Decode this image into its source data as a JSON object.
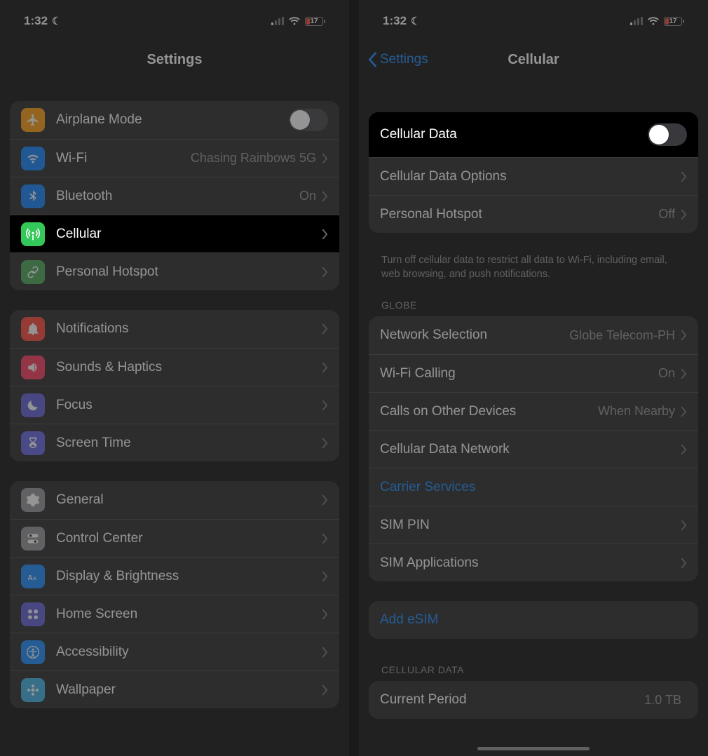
{
  "status": {
    "time": "1:32",
    "battery": "17"
  },
  "left": {
    "title": "Settings",
    "g1": {
      "airplane": "Airplane Mode",
      "wifi": "Wi-Fi",
      "wifi_detail": "Chasing Rainbows 5G",
      "bluetooth": "Bluetooth",
      "bluetooth_detail": "On",
      "cellular": "Cellular",
      "hotspot": "Personal Hotspot"
    },
    "g2": {
      "notifications": "Notifications",
      "sounds": "Sounds & Haptics",
      "focus": "Focus",
      "screentime": "Screen Time"
    },
    "g3": {
      "general": "General",
      "control": "Control Center",
      "display": "Display & Brightness",
      "home": "Home Screen",
      "accessibility": "Accessibility",
      "wallpaper": "Wallpaper"
    }
  },
  "right": {
    "back": "Settings",
    "title": "Cellular",
    "g1": {
      "cellular_data": "Cellular Data",
      "options": "Cellular Data Options",
      "hotspot": "Personal Hotspot",
      "hotspot_detail": "Off"
    },
    "footer1": "Turn off cellular data to restrict all data to Wi-Fi, including email, web browsing, and push notifications.",
    "carrier_header": "GLOBE",
    "g2": {
      "network_sel": "Network Selection",
      "network_sel_detail": "Globe Telecom-PH",
      "wifi_calling": "Wi-Fi Calling",
      "wifi_calling_detail": "On",
      "other_devices": "Calls on Other Devices",
      "other_devices_detail": "When Nearby",
      "data_network": "Cellular Data Network",
      "carrier_services": "Carrier Services",
      "sim_pin": "SIM PIN",
      "sim_apps": "SIM Applications"
    },
    "g3": {
      "add_esim": "Add eSIM"
    },
    "data_header": "CELLULAR DATA",
    "g4": {
      "current_period": "Current Period",
      "current_period_detail": "1.0 TB"
    }
  }
}
